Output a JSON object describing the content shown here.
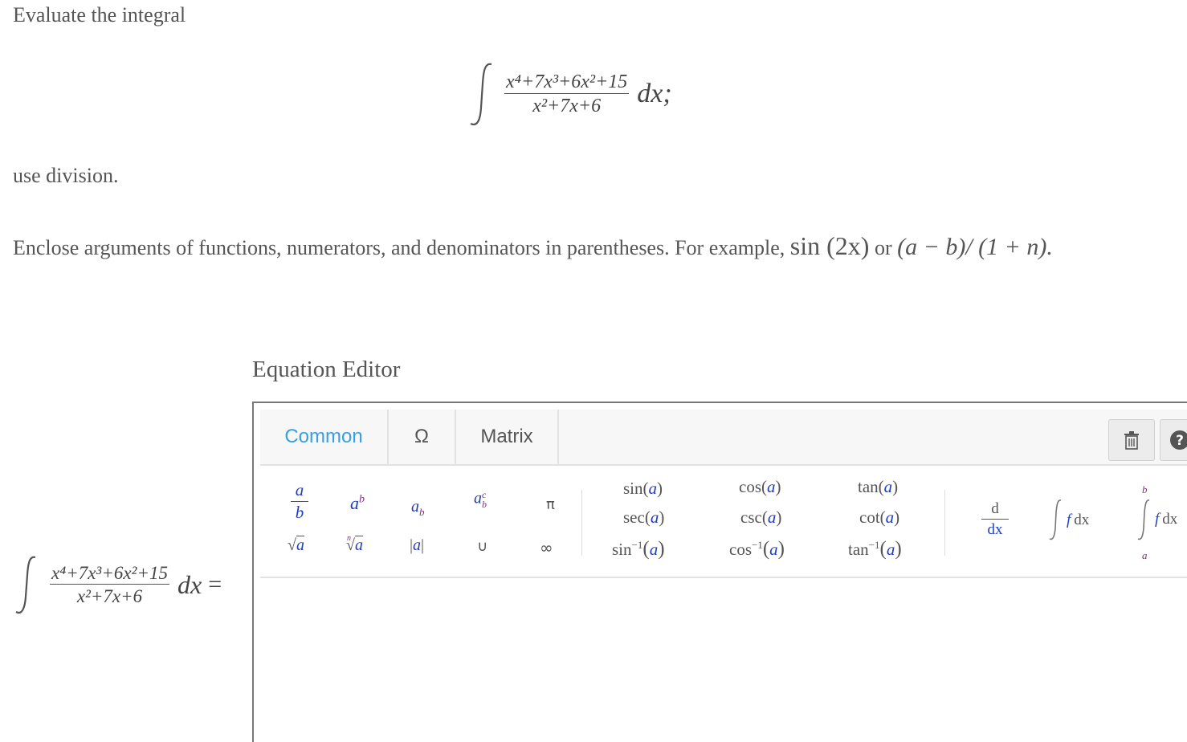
{
  "question": {
    "prompt": "Evaluate the integral",
    "integrand_numerator": "x⁴+7x³+6x²+15",
    "integrand_denominator": "x²+7x+6",
    "differential": "dx;",
    "instruction": "use division.",
    "hint_prefix": "Enclose arguments of functions, numerators, and denominators in parentheses. For example, ",
    "hint_example1": "sin (2x)",
    "hint_or": " or ",
    "hint_example2": "(a − b)/ (1 + n)."
  },
  "answer_lhs": {
    "numerator": "x⁴+7x³+6x²+15",
    "denominator": "x²+7x+6",
    "differential": "dx",
    "equals": "="
  },
  "editor": {
    "title": "Equation Editor",
    "tabs": [
      {
        "label": "Common",
        "active": true
      },
      {
        "label": "Ω",
        "active": false
      },
      {
        "label": "Matrix",
        "active": false
      }
    ],
    "icons": {
      "delete": "trash-icon",
      "help": "help-icon"
    },
    "palette": {
      "sqrt": "√a",
      "abs": "|a|",
      "union": "∪",
      "pi": "π",
      "infinity": "∞",
      "trig": [
        [
          "sin",
          "cos",
          "tan"
        ],
        [
          "sec",
          "csc",
          "cot"
        ],
        [
          "sin",
          "cos",
          "tan"
        ]
      ],
      "arg": "a",
      "inverse": "−1",
      "deriv_top": "d",
      "deriv_bottom": "dx",
      "int_f": "f",
      "int_dx": "dx",
      "def_upper": "b",
      "def_lower": "a"
    },
    "colors": {
      "accent": "#3a9ee0",
      "variable": "#1f3fbf",
      "power": "#8a2a8a"
    }
  }
}
